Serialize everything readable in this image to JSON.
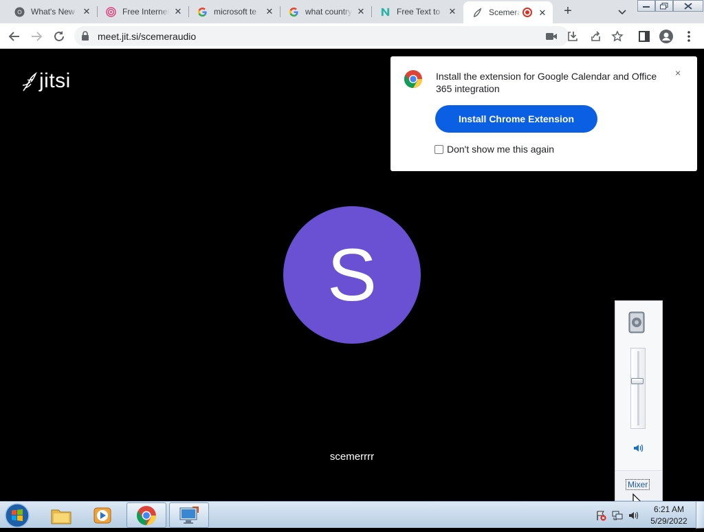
{
  "browser": {
    "tabs": [
      {
        "title": "What's New",
        "icon": "chrome-icon"
      },
      {
        "title": "Free Internet",
        "icon": "target-icon"
      },
      {
        "title": "microsoft te",
        "icon": "google-icon"
      },
      {
        "title": "what country",
        "icon": "google-icon"
      },
      {
        "title": "Free Text to",
        "icon": "n-logo-icon"
      },
      {
        "title": "Scemera",
        "icon": "jitsi-icon",
        "active": true
      }
    ],
    "address": "meet.jit.si/scemeraudio"
  },
  "page": {
    "logo_text": "jitsi",
    "avatar_letter": "S",
    "avatar_color": "#6a50d3",
    "display_name": "scemerrrr"
  },
  "extension_popup": {
    "message": "Install the extension for Google Calendar and Office 365 integration",
    "install_label": "Install Chrome Extension",
    "dont_show_label": "Don't show me this again",
    "close_symbol": "×"
  },
  "volume_flyout": {
    "mixer_label": "Mixer",
    "level": 0.6
  },
  "taskbar": {
    "time": "6:21 AM",
    "date": "5/29/2022"
  },
  "colors": {
    "accent_button": "#0b5fe2",
    "page_background": "#000000"
  }
}
